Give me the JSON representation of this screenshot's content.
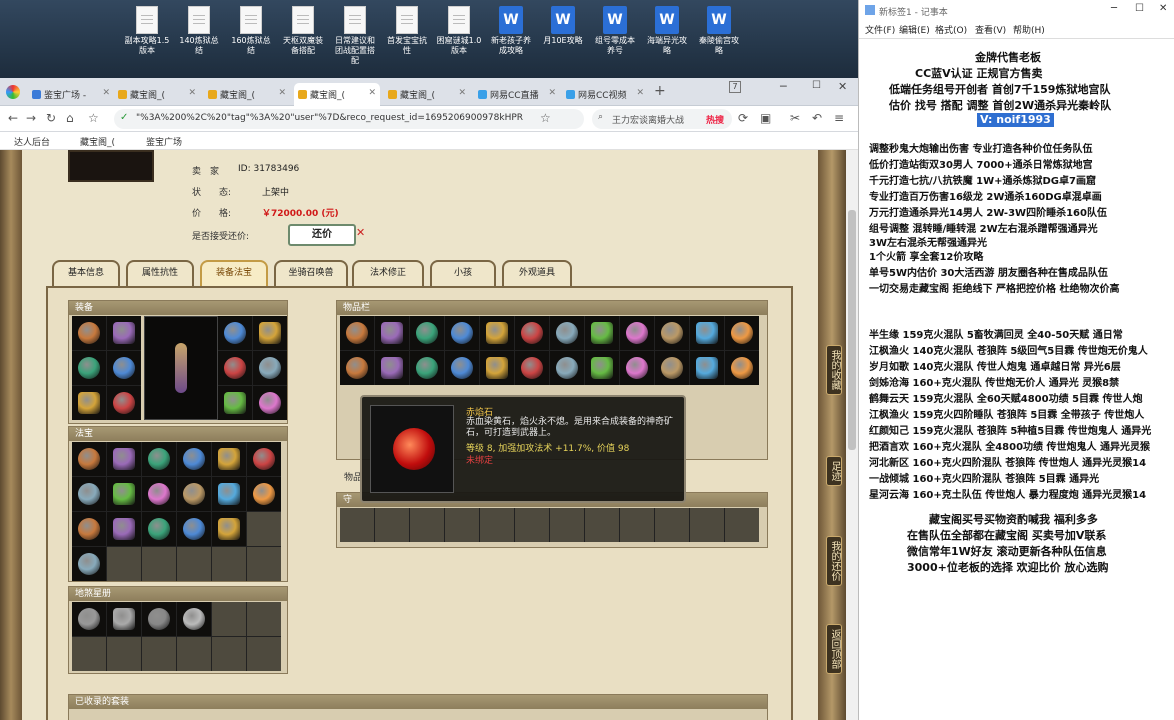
{
  "desktop": {
    "icons": [
      {
        "label": "副本攻略1.5版本",
        "type": "doc"
      },
      {
        "label": "140炼狱总结",
        "type": "doc"
      },
      {
        "label": "160炼狱总结",
        "type": "doc"
      },
      {
        "label": "天枢双魔装备搭配",
        "type": "doc"
      },
      {
        "label": "日常建议和团战配置搭配",
        "type": "doc"
      },
      {
        "label": "首发宝宝抗性",
        "type": "doc"
      },
      {
        "label": "困窟谜城1.0版本",
        "type": "doc"
      },
      {
        "label": "新老孩子养成攻略",
        "type": "word"
      },
      {
        "label": "月10E攻略",
        "type": "word"
      },
      {
        "label": "组号零成本养号",
        "type": "word"
      },
      {
        "label": "海端异光攻略",
        "type": "word"
      },
      {
        "label": "秦陵偷宫攻略",
        "type": "word"
      }
    ]
  },
  "browser": {
    "tabs": [
      {
        "label": "鉴宝广场 -",
        "color": "#3b7bd8"
      },
      {
        "label": "藏宝阁_(",
        "color": "#e8a81b"
      },
      {
        "label": "藏宝阁_(",
        "color": "#e8a81b"
      },
      {
        "label": "藏宝阁_(",
        "color": "#e8a81b"
      },
      {
        "label": "藏宝阁_(",
        "color": "#e8a81b"
      },
      {
        "label": "网易CC直播",
        "color": "#3aa0e8"
      },
      {
        "label": "网易CC视频",
        "color": "#3aa0e8"
      }
    ],
    "tab_count": "7",
    "url": "\"%3A%200%2C%20\"tag\"%3A%20\"user\"%7D&reco_request_id=1695206900978kHPR",
    "search_placeholder": "王力宏谈离婚大战",
    "hot_label": "热搜",
    "bookmarks": [
      "达人后台",
      "藏宝阁_(",
      "鉴宝广场"
    ]
  },
  "listing": {
    "seller_label": "卖　家",
    "seller_id": "ID:  31783496",
    "status_label": "状　　态:",
    "status_value": "上架中",
    "price_label": "价　　格:",
    "price_value": "￥72000.00 (元)",
    "counter_label": "是否接受还价:",
    "counter_button": "还价"
  },
  "tabs": [
    {
      "label": "基本信息",
      "active": false
    },
    {
      "label": "属性抗性",
      "active": false
    },
    {
      "label": "装备法宝",
      "active": true
    },
    {
      "label": "坐骑召唤兽",
      "active": false
    },
    {
      "label": "法术修正",
      "active": false
    },
    {
      "label": "小孩",
      "active": false
    },
    {
      "label": "外观道具",
      "active": false
    }
  ],
  "sections": {
    "equipment": "装备",
    "fabao": "法宝",
    "dizhi": "地煞星册",
    "collected": "已收录的套装",
    "inventory": "物品栏",
    "shou": "守",
    "wupin": "物品"
  },
  "tooltip": {
    "name": "赤焰石",
    "desc": "赤血染黄石，焰火永不熄。是用来合成装备的神奇矿石，可打造到武器上。",
    "stat": "等级 8, 加强加攻法术 +11.7%, 价值 98",
    "status": "未绑定"
  },
  "side_buttons": [
    "我的收藏",
    "足迹",
    "我的还价",
    "返回顶部"
  ],
  "notepad": {
    "title": "新标签1 - 记事本",
    "menu": [
      "文件(F)",
      "编辑(E)",
      "格式(O)",
      "查看(V)",
      "帮助(H)"
    ],
    "lines": [
      "金牌代售老板",
      "CC蓝V认证  正规官方售卖",
      "低端任务组号开创者            首创7千159炼狱地宫队",
      "估价 找号 搭配 调整            首创2W通杀异光秦岭队",
      "V:  noif1993",
      "调整秒鬼大炮输出伤害            专业打造各种价位任务队伍",
      "低价打造站街双30男人            7000+通杀日常炼狱地宫",
      "千元打造七抗/八抗铁魔            1W+通杀炼狱DG卓7画窟",
      "专业打造百万伤害16级龙          2W通杀160DG卓混卓画",
      "万元打造通杀异光14男人          2W-3W四阶睡杀160队伍",
      "组号调整 混转睡/睡转混            2W左右混杀蹭帮强通异光",
      "                                          3W左右混杀无帮强通异光",
      "1个火箭 享全套12价攻略",
      "单号5W内估价 30大活西游          朋友圈各种在售成品队伍",
      "一切交易走藏宝阁 拒绝线下      严格把控价格 杜绝物次价高",
      "半生缘    159克火混队 5畜牧满回灵 全40-50天赋 通日常",
      "江枫渔火 140克火混队 苍狼阵 5级回气5目霖 传世炮无价鬼人",
      "岁月如歌 140克火混队 传世人炮鬼 通卓越日常 异光6层",
      "剑姊沧海 160+克火混队 传世炮无价人 通异光 灵猴8禁",
      "鹤舞云天 159克火混队 全60天赋4800功绩 5目霖 传世人炮",
      "江枫渔火 159克火四阶睡队 苍狼阵 5目霖 全带孩子 传世炮人",
      "红颜知己 159克火混队 苍狼阵 5种植5目霖 传世炮鬼人 通异光",
      "把酒言欢 160+克火混队 全4800功绩 传世炮鬼人 通异光灵猴",
      "河北新区 160+克火四阶混队 苍狼阵 传世炮人 通异光灵猴14",
      "一战倾城 160+克火四阶混队 苍狼阵 5目霖 通异光",
      "星河云海 160+克土队伍 传世炮人 暴力程度炮 通异光灵猴14",
      "藏宝阁买号买物资酌喊我 福利多多",
      "在售队伍全部都在藏宝阁 买卖号加V联系",
      "微信常年1W好友 滚动更新各种队伍信息",
      "3000+位老板的选择 欢迎比价 放心选购"
    ]
  },
  "colors": {
    "price": "#d01818",
    "tooltip_name": "#f3c64a",
    "tooltip_stat": "#e6d35a",
    "tooltip_status": "#e04040",
    "selection": "#2f6fd1"
  }
}
